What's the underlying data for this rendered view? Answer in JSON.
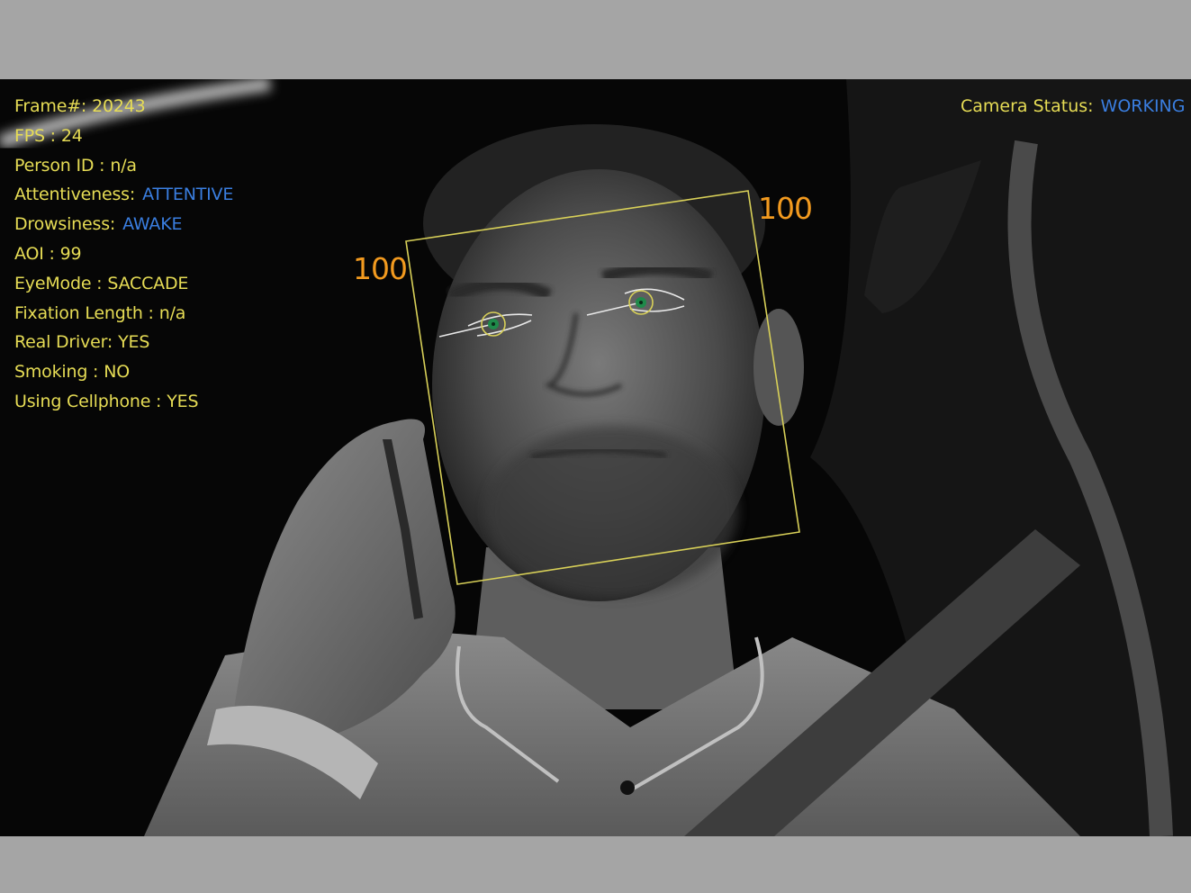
{
  "hud": {
    "left_panel": [
      {
        "label": "Frame#:",
        "value": "20243",
        "value_color": "yellow"
      },
      {
        "label": "FPS :",
        "value": "24",
        "value_color": "yellow"
      },
      {
        "label": "Person ID :",
        "value": "n/a",
        "value_color": "yellow"
      },
      {
        "label": "Attentiveness:",
        "value": "ATTENTIVE",
        "value_color": "blue"
      },
      {
        "label": "Drowsiness:",
        "value": "AWAKE",
        "value_color": "blue"
      },
      {
        "label": "AOI :",
        "value": "99",
        "value_color": "yellow"
      },
      {
        "label": "EyeMode :",
        "value": "SACCADE",
        "value_color": "yellow"
      },
      {
        "label": "Fixation Length :",
        "value": "n/a",
        "value_color": "yellow"
      },
      {
        "label": "Real Driver:",
        "value": "YES",
        "value_color": "yellow"
      },
      {
        "label": "Smoking :",
        "value": "NO",
        "value_color": "yellow"
      },
      {
        "label": "Using Cellphone :",
        "value": "YES",
        "value_color": "yellow"
      }
    ],
    "camera_status": {
      "label": "Camera Status:",
      "value": "WORKING"
    }
  },
  "face_box": {
    "left_score": "100",
    "right_score": "100"
  },
  "colors": {
    "label_yellow": "#e6dc55",
    "value_blue": "#3a7ee0",
    "score_orange": "#f29a1f",
    "box_yellow": "#d8d058",
    "iris_green": "#1f8a4a",
    "letterbox_gray": "#a5a5a5"
  }
}
